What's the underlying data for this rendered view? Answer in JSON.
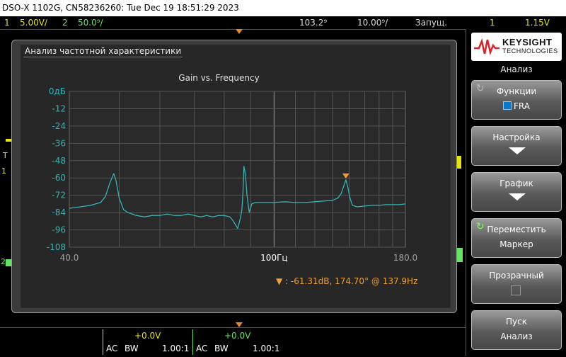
{
  "window": {
    "title": "DSO-X 1102G, CN58236260: Tue Dec 19 18:51:29 2023"
  },
  "status": {
    "ch1_num": "1",
    "ch1_scale": "5.00V/",
    "ch2_num": "2",
    "ch2_scale": "50.0⁹/",
    "time_delay": "103.2⁹",
    "time_scale": "10.00⁹/",
    "run_state": "Запущ.",
    "trig_ch": "1",
    "trig_level": "1.15V"
  },
  "scope": {
    "trig_marker": "T",
    "ch1_marker": "1",
    "ch2_marker": "2"
  },
  "dialog": {
    "title": "Анализ частотной характеристики",
    "marker_symbol": "▼",
    "marker_readout": ": -61.31dB, 174.70° @ 137.9Hz"
  },
  "chart_data": {
    "type": "line",
    "title": "Gain vs. Frequency",
    "xscale": "log",
    "xlim": [
      40.0,
      180.0
    ],
    "x_tick_labels": [
      "40.0",
      "100Гц",
      "180.0"
    ],
    "x_tick_values": [
      40,
      100,
      180
    ],
    "ylim": [
      -108,
      0
    ],
    "y_ticks": [
      0,
      -12,
      -24,
      -36,
      -48,
      -60,
      -72,
      -84,
      -96,
      -108
    ],
    "y_tick_labels": [
      "0дБ",
      "-12",
      "-24",
      "-36",
      "-48",
      "-60",
      "-72",
      "-84",
      "-96",
      "-108"
    ],
    "grid": true,
    "line_color": "#34b4b4",
    "marker_color": "#f0a030",
    "marker": {
      "x": 137.9,
      "y": -61.31
    },
    "series": [
      {
        "x": [
          40,
          42,
          44,
          46,
          47,
          48,
          48.8,
          49.3,
          50,
          51,
          52,
          54,
          56,
          58,
          60,
          62,
          64,
          66,
          68,
          70,
          72,
          74,
          76,
          78,
          80,
          82,
          83,
          84,
          85,
          86,
          86.6,
          87,
          87.4,
          88,
          88.6,
          89.5,
          90.5,
          92,
          95,
          100,
          105,
          110,
          115,
          120,
          125,
          130,
          133,
          135,
          136.5,
          137.9,
          139,
          140.5,
          142,
          145,
          150,
          155,
          160,
          165,
          170,
          175,
          180
        ],
        "y": [
          -81,
          -80,
          -79,
          -77,
          -73,
          -63,
          -57,
          -62,
          -74,
          -82,
          -84,
          -86,
          -87,
          -86,
          -86,
          -85,
          -86,
          -86,
          -85,
          -86,
          -87,
          -86,
          -87,
          -86,
          -86,
          -87,
          -89,
          -92,
          -95,
          -88,
          -82,
          -70,
          -52,
          -58,
          -72,
          -84,
          -78,
          -77,
          -77,
          -77,
          -76.5,
          -77,
          -77,
          -76.5,
          -76,
          -75.5,
          -74,
          -71,
          -66,
          -61.3,
          -66,
          -74,
          -79,
          -80,
          -79.5,
          -79,
          -79,
          -78.5,
          -78.5,
          -78.5,
          -78
        ]
      }
    ]
  },
  "bottom": {
    "ch1_offset": "+0.0V",
    "ch1_coupling": "AC",
    "ch1_bw": "BW",
    "ch1_probe": "1.00:1",
    "ch2_offset": "+0.0V",
    "ch2_coupling": "AC",
    "ch2_bw": "BW",
    "ch2_probe": "1.00:1"
  },
  "softkeys": {
    "brand_name": "KEYSIGHT",
    "brand_sub": "TECHNOLOGIES",
    "heading": "Анализ",
    "k1_label": "Функции",
    "k1_value": "FRA",
    "k2_label": "Настройка",
    "k3_label": "График",
    "k4_label": "Переместить",
    "k4_value": "Маркер",
    "k5_label": "Прозрачный",
    "k6_label": "Пуск",
    "k6_value": "Анализ"
  },
  "colors": {
    "ch1": "#e6e600",
    "ch2": "#5ee85e",
    "accent": "#f0a030",
    "trace": "#34b4b4"
  }
}
